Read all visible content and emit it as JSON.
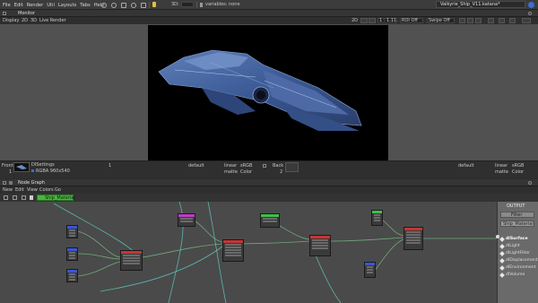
{
  "menubar": {
    "items": [
      "File",
      "Edit",
      "Render",
      "Util",
      "Layouts",
      "Tabs",
      "Help"
    ],
    "mode3d": "3D:",
    "variables": "variables: none",
    "doc_title": "Valkyrie_Ship_V11.katana*",
    "info_icon": "info-icon"
  },
  "monitor": {
    "title": "Monitor",
    "tabs": [
      "Display",
      "2D",
      "3D",
      "Live Render"
    ],
    "controls": {
      "view2d": "2D",
      "ratio": "1 : 1.11",
      "roi": "ROI Off",
      "swipe": "Swipe Off"
    },
    "footer": {
      "front_label": "Front",
      "front_index": "1",
      "image_name": "DlSettings",
      "image_info": "RGBA 960x540",
      "frame": "1",
      "view_left": "default",
      "space_left": "linear",
      "srgb_left": "sRGB",
      "matte_left": "matte",
      "color_left": "Color",
      "back_label": "Back",
      "back_index": "2",
      "view_right": "default",
      "space_right": "linear",
      "srgb_right": "sRGB",
      "matte_right": "matte",
      "color_right": "Color"
    }
  },
  "nodegraph": {
    "title": "Node Graph",
    "menu": [
      "New",
      "Edit",
      "View",
      "Colors",
      "Go"
    ],
    "breadcrumb": "Ship_Material",
    "output": {
      "header": "OUTPUT",
      "filter_label": "Filter",
      "material_label": "Ship_Material",
      "items": [
        "dlSurface",
        "dlLight",
        "dlLightFilter",
        "dlDisplacement",
        "dlEnvironment",
        "dlVolume"
      ]
    }
  },
  "colors": {
    "accent_green": "#45b83c",
    "node_blue": "#3a56d6",
    "node_red": "#c83434",
    "node_magenta": "#c03ac8",
    "node_green": "#3fbf4a",
    "wire_green": "#6fa97a",
    "wire_teal": "#5ab6b0"
  }
}
